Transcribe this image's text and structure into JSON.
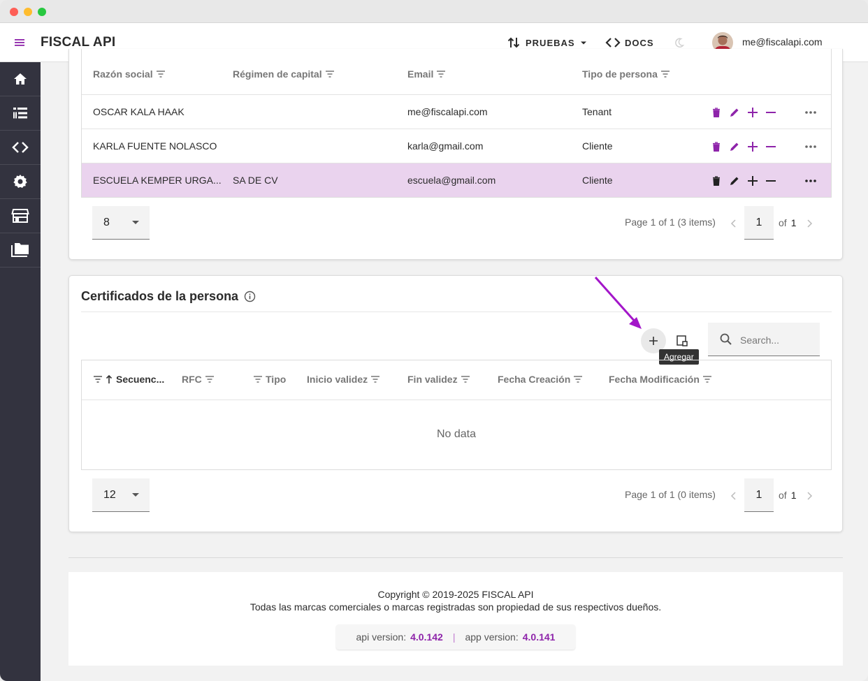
{
  "header": {
    "brand": "FISCAL API",
    "env_label": "PRUEBAS",
    "docs_label": "DOCS",
    "user_email": "me@fiscalapi.com"
  },
  "sidebar": {
    "items": [
      {
        "icon": "home-icon"
      },
      {
        "icon": "list-tree-icon"
      },
      {
        "icon": "code-icon"
      },
      {
        "icon": "gear-icon"
      },
      {
        "icon": "store-icon"
      },
      {
        "icon": "folder-icon"
      }
    ]
  },
  "people_table": {
    "columns": [
      "Razón social",
      "Régimen de capital",
      "Email",
      "Tipo de persona"
    ],
    "rows": [
      {
        "razon": "OSCAR KALA HAAK",
        "regimen": "",
        "email": "me@fiscalapi.com",
        "tipo": "Tenant"
      },
      {
        "razon": "KARLA FUENTE NOLASCO",
        "regimen": "",
        "email": "karla@gmail.com",
        "tipo": "Cliente"
      },
      {
        "razon": "ESCUELA KEMPER URGA...",
        "regimen": "SA DE CV",
        "email": "escuela@gmail.com",
        "tipo": "Cliente"
      }
    ],
    "page_size": "8",
    "page_info": "Page 1 of 1 (3 items)",
    "page_number": "1",
    "of_label": "of",
    "total_pages": "1"
  },
  "certificates": {
    "title": "Certificados de la persona",
    "add_tooltip": "Agregar",
    "search_placeholder": "Search...",
    "columns": [
      "Secuenc...",
      "RFC",
      "Tipo",
      "Inicio validez",
      "Fin validez",
      "Fecha Creación",
      "Fecha Modificación"
    ],
    "no_data": "No data",
    "page_size": "12",
    "page_info": "Page 1 of 1 (0 items)",
    "page_number": "1",
    "of_label": "of",
    "total_pages": "1"
  },
  "footer": {
    "copyright": "Copyright © 2019-2025 FISCAL API",
    "trademark": "Todas las marcas comerciales o marcas registradas son propiedad de sus respectivos dueños.",
    "api_label": "api version:",
    "api_version": "4.0.142",
    "separator": "|",
    "app_label": "app version:",
    "app_version": "4.0.141"
  },
  "colors": {
    "accent": "#8e24aa",
    "sidebar": "#33333f",
    "selected_row": "#ead3ee"
  }
}
